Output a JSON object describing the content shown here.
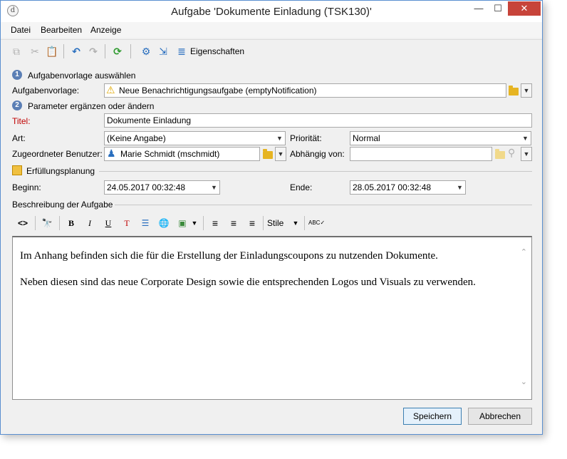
{
  "window": {
    "title": "Aufgabe 'Dokumente Einladung (TSK130)'",
    "app_icon_glyph": "d",
    "controls": {
      "minimize": "—",
      "maximize": "☐",
      "close": "✕"
    }
  },
  "menu": {
    "items": [
      "Datei",
      "Bearbeiten",
      "Anzeige"
    ]
  },
  "toolbar": {
    "icons": [
      "copy-icon",
      "cut-icon",
      "paste-icon",
      "undo-icon",
      "redo-icon",
      "refresh-icon",
      "settings-icon",
      "export-icon",
      "properties-icon"
    ],
    "glyphs": {
      "copy": "⧉",
      "cut": "✂",
      "paste": "📋",
      "undo": "↶",
      "redo": "↷",
      "refresh": "⟳",
      "settings": "⚙",
      "export": "⇲",
      "properties": "≣"
    },
    "properties_label": "Eigenschaften"
  },
  "section1": {
    "number": "1",
    "title": "Aufgabenvorlage auswählen",
    "template_label": "Aufgabenvorlage:",
    "template_value": "Neue Benachrichtigungsaufgabe (emptyNotification)",
    "warning_glyph": "⚠"
  },
  "section2": {
    "number": "2",
    "title": "Parameter ergänzen oder ändern",
    "titel_label": "Titel:",
    "titel_value": "Dokumente Einladung",
    "art_label": "Art:",
    "art_value": "(Keine Angabe)",
    "prioritaet_label": "Priorität:",
    "prioritaet_value": "Normal",
    "benutzer_label": "Zugeordneter Benutzer:",
    "benutzer_value": "Marie Schmidt (mschmidt)",
    "abhaengig_label": "Abhängig von:",
    "abhaengig_value": "",
    "search_glyph": "⚲"
  },
  "planning": {
    "title": "Erfüllungsplanung",
    "beginn_label": "Beginn:",
    "beginn_value": "24.05.2017 00:32:48",
    "ende_label": "Ende:",
    "ende_value": "28.05.2017 00:32:48"
  },
  "description": {
    "title": "Beschreibung der Aufgabe",
    "editor_toolbar": {
      "source": "<>",
      "find": "🔭",
      "bold": "B",
      "italic": "I",
      "underline": "U",
      "clear_format": "T",
      "list": "☰",
      "link": "🌐",
      "image": "▣",
      "align_left": "≡",
      "align_center": "≡",
      "align_right": "≡",
      "style_label": "Stile",
      "spellcheck": "ABC✓"
    },
    "paragraphs": [
      "Im Anhang befinden sich die für die Erstellung der Einladungscoupons zu nutzenden Dokumente.",
      "Neben diesen sind das neue Corporate Design sowie die entsprechenden Logos und Visuals zu verwenden."
    ]
  },
  "buttons": {
    "save": "Speichern",
    "cancel": "Abbrechen"
  },
  "colors": {
    "accent": "#5b7fb5",
    "required_label": "#c00000",
    "folder": "#e6b422",
    "close_button": "#c7443a"
  }
}
